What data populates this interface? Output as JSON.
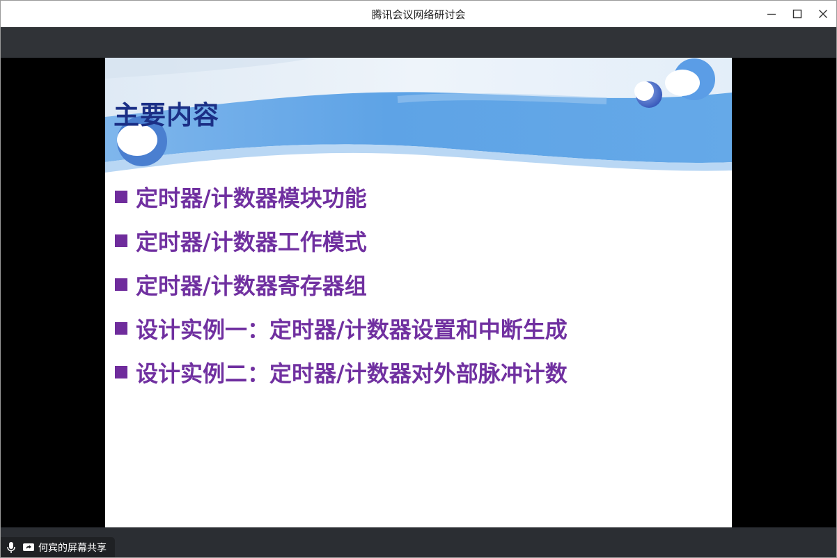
{
  "window": {
    "title": "腾讯会议网络研讨会"
  },
  "slide": {
    "title": "主要内容",
    "bullets": [
      "定时器/计数器模块功能",
      "定时器/计数器工作模式",
      "定时器/计数器寄存器组",
      "设计实例一：定时器/计数器设置和中断生成",
      "设计实例二：定时器/计数器对外部脉冲计数"
    ],
    "title_color": "#1b2f86",
    "bullet_color": "#7030a0",
    "bullet_marker_color": "#6f2c9c",
    "banner_color": "#5ea3e6"
  },
  "status": {
    "share_label": "何宾的屏幕共享"
  },
  "icons": {
    "minimize": "minimize-icon",
    "maximize": "maximize-icon",
    "close": "close-icon",
    "mic": "microphone-icon",
    "screen_share": "screen-share-icon"
  }
}
